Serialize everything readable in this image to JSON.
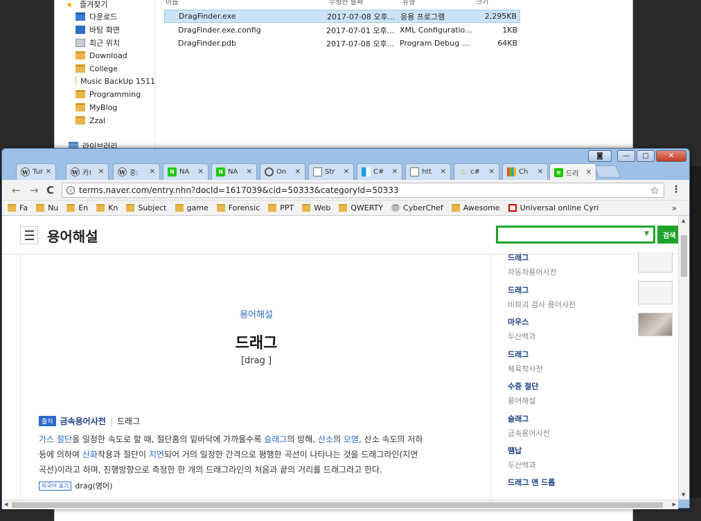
{
  "explorer": {
    "columns": [
      "이름",
      "수정한 날짜",
      "유형",
      "크기"
    ],
    "nav_items": [
      {
        "label": "즐겨찾기",
        "icon": "star-icon"
      },
      {
        "label": "다운로드",
        "icon": "download-folder-icon"
      },
      {
        "label": "바탕 화면",
        "icon": "desktop-icon"
      },
      {
        "label": "최근 위치",
        "icon": "recent-places-icon"
      },
      {
        "label": "Download",
        "icon": "folder-icon"
      },
      {
        "label": "College",
        "icon": "folder-icon"
      },
      {
        "label": "Music BackUp 1511",
        "icon": "folder-icon"
      },
      {
        "label": "Programming",
        "icon": "folder-icon"
      },
      {
        "label": "MyBlog",
        "icon": "folder-icon"
      },
      {
        "label": "Zzal",
        "icon": "folder-icon"
      },
      {
        "label": "라이브러리",
        "icon": "library-icon"
      }
    ],
    "files": [
      {
        "name": "DragFinder.exe",
        "date": "2017-07-08 오후...",
        "type": "응용 프로그램",
        "size": "2,295KB",
        "selected": true
      },
      {
        "name": "DragFinder.exe.config",
        "date": "2017-07-01 오후...",
        "type": "XML Configuratio...",
        "size": "1KB",
        "selected": false
      },
      {
        "name": "DragFinder.pdb",
        "date": "2017-07-08 오후...",
        "type": "Program Debug ...",
        "size": "64KB",
        "selected": false
      }
    ]
  },
  "chrome": {
    "tabs": [
      {
        "label": "Tur",
        "icon": "wikipedia-icon"
      },
      {
        "label": "카!",
        "icon": "wikipedia-icon"
      },
      {
        "label": "중:",
        "icon": "wikipedia-icon"
      },
      {
        "label": "NA",
        "icon": "naver-icon"
      },
      {
        "label": "NA",
        "icon": "naver-icon"
      },
      {
        "label": "On",
        "icon": "circle-icon"
      },
      {
        "label": "Str",
        "icon": "document-icon"
      },
      {
        "label": "C#",
        "icon": "windows-icon"
      },
      {
        "label": "htt",
        "icon": "document-icon"
      },
      {
        "label": "c#",
        "icon": "csharp-icon"
      },
      {
        "label": "Ch",
        "icon": "microsoft-icon"
      },
      {
        "label": "드리",
        "icon": "terms-icon",
        "active": true
      }
    ],
    "url": "terms.naver.com/entry.nhn?docId=1617039&cid=50333&categoryId=50333",
    "bookmarks": [
      "Fa",
      "Nu",
      "En",
      "Kn",
      "Subject",
      "game",
      "Forensic",
      "PPT",
      "Web",
      "QWERTY",
      "CyberChef",
      "Awesome",
      "Universal online Cyri"
    ],
    "bookmarks_more": "»"
  },
  "site": {
    "title": "용어해설",
    "search_button": "검색",
    "search_value": ""
  },
  "article": {
    "category": "용어해설",
    "title": "드래그",
    "subtitle": "[drag ]",
    "source_badge": "출처",
    "source_dict": "금속용어사전",
    "source_sep": "|",
    "source_term": "드래그",
    "body_parts": {
      "l1a": "가스 절단",
      "l1b": "을 일정한 속도로 할 때, 절단홈의 밑바닥에 가까울수록 ",
      "l1c": "슬래그",
      "l1d": "의 방해, ",
      "l1e": "산소",
      "l1f": "의 ",
      "l1g": "오염",
      "l1h": ", 산소 속도의 저하",
      "l2a": "등에 의하여 ",
      "l2b": "산화",
      "l2c": "작용과 절단이 ",
      "l2d": "지연",
      "l2e": "되어 거의 일정한 간격으로 평행한 곡선이 나타나는 것을 드래그라인(지연",
      "l3": "곡선)이라고 하며, 진행방향으로 측정한 한 개의 드래그라인의 처음과 끝의 거리를 드래그라고 한다."
    },
    "foreign_badge": "외국어 표기",
    "foreign_value": "drag(영어)"
  },
  "related": [
    {
      "title": "드래그",
      "source": "자동차용어사전"
    },
    {
      "title": "드래그",
      "source": "비파괴 검사 용어사전"
    },
    {
      "title": "마우스",
      "source": "두산백과"
    },
    {
      "title": "드래그",
      "source": "체육학사전"
    },
    {
      "title": "수중 절단",
      "source": "용어해설"
    },
    {
      "title": "슬래그",
      "source": "금속용어사전"
    },
    {
      "title": "땜납",
      "source": "두산백과"
    },
    {
      "title": "드래그 앤 드롭",
      "source": ""
    }
  ]
}
